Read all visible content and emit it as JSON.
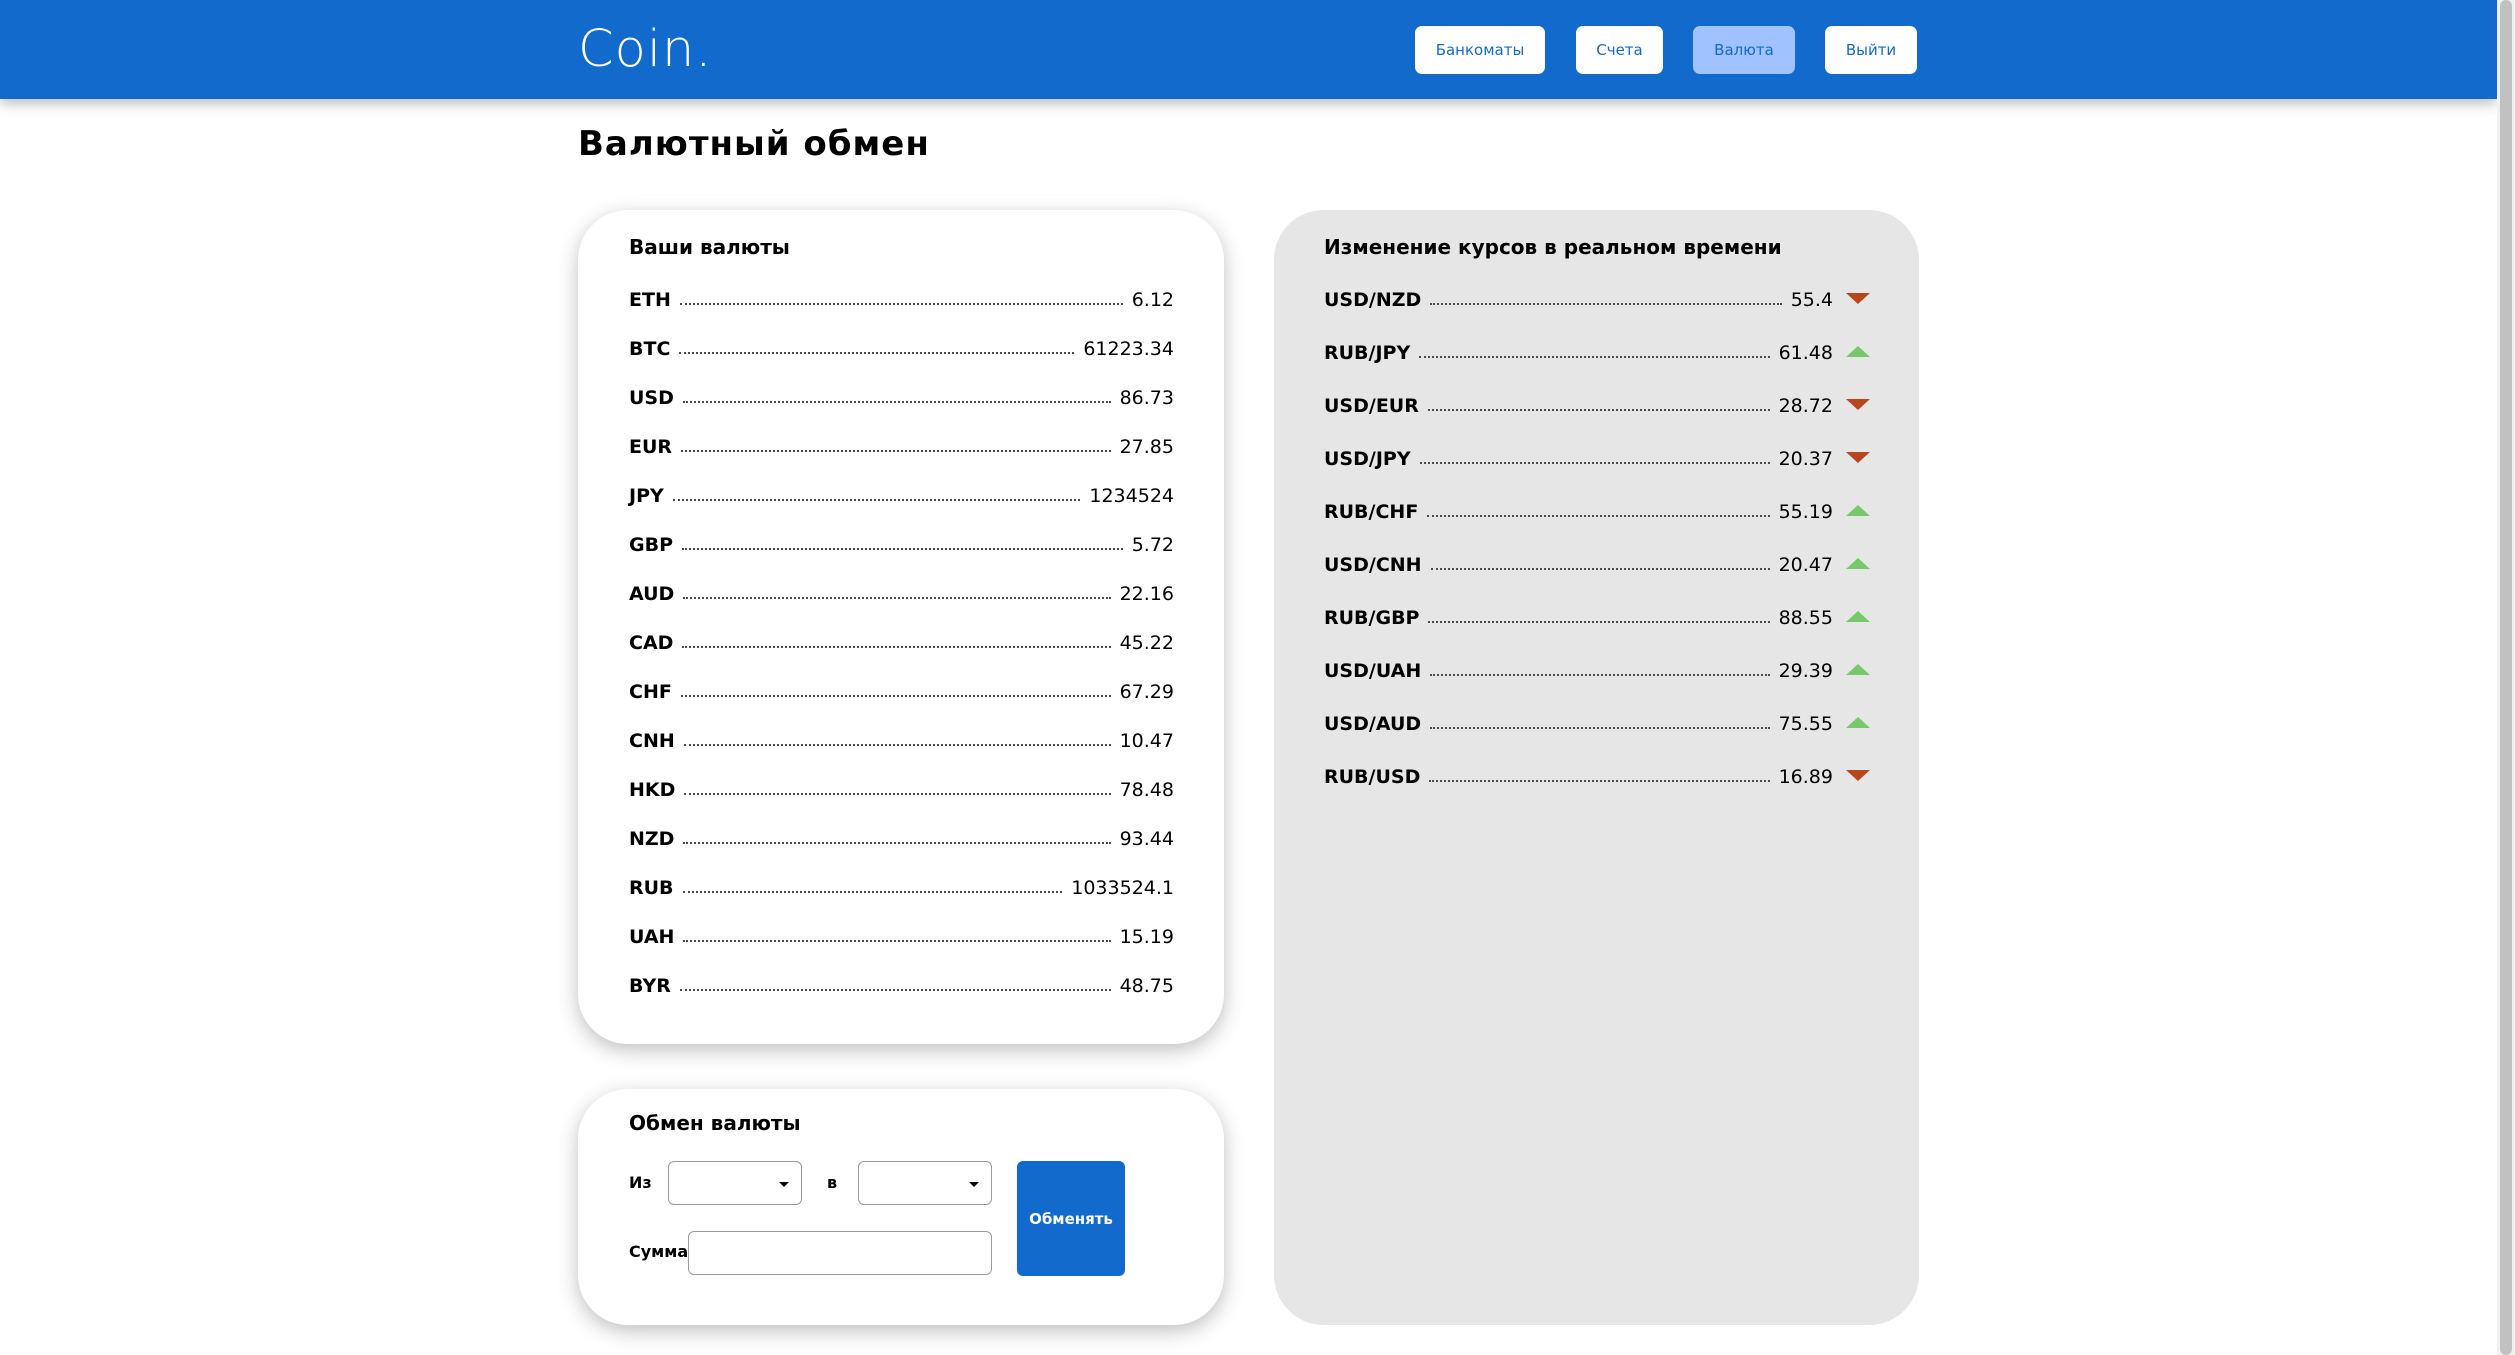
{
  "header": {
    "logo": "Coin.",
    "nav": {
      "atms": "Банкоматы",
      "accounts": "Счета",
      "currency": "Валюта",
      "logout": "Выйти"
    },
    "active_tab": "currency"
  },
  "page_title": "Валютный обмен",
  "your_currencies": {
    "title": "Ваши валюты",
    "items": [
      {
        "code": "ETH",
        "value": "6.12"
      },
      {
        "code": "BTC",
        "value": "61223.34"
      },
      {
        "code": "USD",
        "value": "86.73"
      },
      {
        "code": "EUR",
        "value": "27.85"
      },
      {
        "code": "JPY",
        "value": "1234524"
      },
      {
        "code": "GBP",
        "value": "5.72"
      },
      {
        "code": "AUD",
        "value": "22.16"
      },
      {
        "code": "CAD",
        "value": "45.22"
      },
      {
        "code": "CHF",
        "value": "67.29"
      },
      {
        "code": "CNH",
        "value": "10.47"
      },
      {
        "code": "HKD",
        "value": "78.48"
      },
      {
        "code": "NZD",
        "value": "93.44"
      },
      {
        "code": "RUB",
        "value": "1033524.1"
      },
      {
        "code": "UAH",
        "value": "15.19"
      },
      {
        "code": "BYR",
        "value": "48.75"
      }
    ]
  },
  "exchange": {
    "title": "Обмен валюты",
    "from_label": "Из",
    "to_label": "в",
    "amount_label": "Сумма",
    "from_value": "",
    "to_value": "",
    "amount_value": "",
    "button_label": "Обменять"
  },
  "rates": {
    "title": "Изменение курсов в реальном времени",
    "items": [
      {
        "pair": "USD/NZD",
        "value": "55.4",
        "trend": "down"
      },
      {
        "pair": "RUB/JPY",
        "value": "61.48",
        "trend": "up"
      },
      {
        "pair": "USD/EUR",
        "value": "28.72",
        "trend": "down"
      },
      {
        "pair": "USD/JPY",
        "value": "20.37",
        "trend": "down"
      },
      {
        "pair": "RUB/CHF",
        "value": "55.19",
        "trend": "up"
      },
      {
        "pair": "USD/CNH",
        "value": "20.47",
        "trend": "up"
      },
      {
        "pair": "RUB/GBP",
        "value": "88.55",
        "trend": "up"
      },
      {
        "pair": "USD/UAH",
        "value": "29.39",
        "trend": "up"
      },
      {
        "pair": "USD/AUD",
        "value": "75.55",
        "trend": "up"
      },
      {
        "pair": "RUB/USD",
        "value": "16.89",
        "trend": "down"
      }
    ]
  },
  "colors": {
    "brand": "#116acc",
    "active_tab_bg": "#a0c3ff",
    "trend_up": "#76c86a",
    "trend_down": "#b8451d",
    "rates_card_bg": "#e6e6e6"
  }
}
